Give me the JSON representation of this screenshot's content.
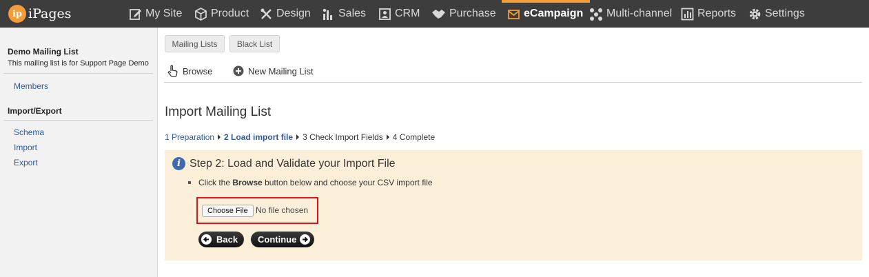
{
  "header": {
    "logo_badge": "ip",
    "logo_text": "iPages",
    "nav": [
      {
        "label": "My Site",
        "icon": "edit-icon"
      },
      {
        "label": "Product",
        "icon": "cube-icon"
      },
      {
        "label": "Design",
        "icon": "design-tools-icon"
      },
      {
        "label": "Sales",
        "icon": "bar-chart-icon"
      },
      {
        "label": "CRM",
        "icon": "contact-card-icon"
      },
      {
        "label": "Purchase",
        "icon": "handshake-icon"
      },
      {
        "label": "eCampaign",
        "icon": "envelope-icon",
        "active": true
      },
      {
        "label": "Multi-channel",
        "icon": "network-icon"
      },
      {
        "label": "Reports",
        "icon": "report-chart-icon"
      },
      {
        "label": "Settings",
        "icon": "gear-icon"
      }
    ]
  },
  "sidebar": {
    "title": "Demo Mailing List",
    "description": "This mailing list is for Support Page Demo",
    "members": "Members",
    "section_heading": "Import/Export",
    "links": [
      "Schema",
      "Import",
      "Export"
    ]
  },
  "main": {
    "tabs": [
      "Mailing Lists",
      "Black List"
    ],
    "actions": {
      "browse": "Browse",
      "new_list": "New Mailing List"
    },
    "page_title": "Import Mailing List",
    "steps": [
      "1 Preparation",
      "2 Load import file",
      "3 Check Import Fields",
      "4 Complete"
    ],
    "panel": {
      "title": "Step 2: Load and Validate your Import File",
      "instruction_prefix": "Click the",
      "instruction_bold": "Browse",
      "instruction_suffix": "button below and choose your CSV import file",
      "choose_file": "Choose File",
      "no_file": "No file chosen",
      "back": "Back",
      "continue": "Continue"
    }
  },
  "colors": {
    "topbar": "#3d3d3d",
    "accent": "#f39c38",
    "link": "#2e5a9c",
    "panel_bg": "#fbefd9",
    "highlight": "#e0101a"
  }
}
